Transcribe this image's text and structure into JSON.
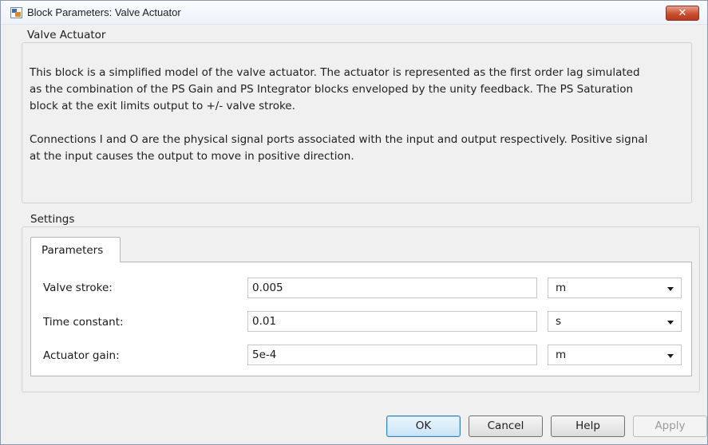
{
  "window": {
    "title": "Block Parameters: Valve Actuator",
    "close_label": "✕"
  },
  "block": {
    "name": "Valve Actuator",
    "description_lines": [
      "This block is a simplified model of the valve actuator. The actuator is represented as the first order lag simulated",
      "as the combination of the PS Gain and PS Integrator blocks enveloped by the unity feedback. The PS Saturation",
      "block at the exit limits output to +/- valve stroke.",
      "Connections I and O are the physical signal ports associated with the input and output respectively. Positive signal",
      "at the input causes the output to move in positive direction."
    ]
  },
  "settings": {
    "label": "Settings",
    "tab_label": "Parameters",
    "params": [
      {
        "label": "Valve stroke:",
        "value": "0.005",
        "unit": "m"
      },
      {
        "label": "Time constant:",
        "value": "0.01",
        "unit": "s"
      },
      {
        "label": "Actuator gain:",
        "value": "5e-4",
        "unit": "m"
      }
    ]
  },
  "buttons": {
    "ok": "OK",
    "cancel": "Cancel",
    "help": "Help",
    "apply": "Apply"
  },
  "colors": {
    "close_button": "#c8502f",
    "default_button_border": "#3c7fb1",
    "disabled_text": "#9a9a9a"
  }
}
